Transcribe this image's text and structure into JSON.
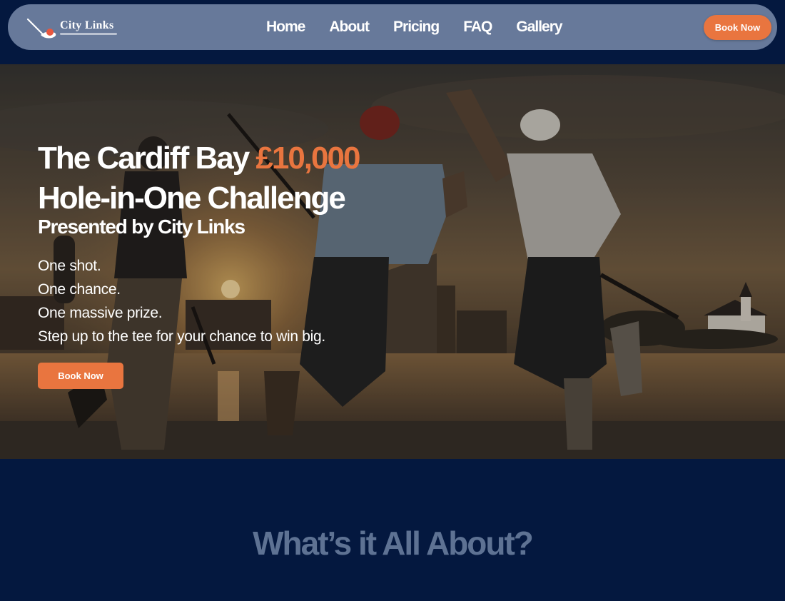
{
  "nav": {
    "logo_text": "City Links",
    "links": [
      "Home",
      "About",
      "Pricing",
      "FAQ",
      "Gallery"
    ],
    "cta_label": "Book Now"
  },
  "hero": {
    "title_part1": "The Cardiff Bay ",
    "title_accent": "£10,000",
    "title_line2": "Hole-in-One Challenge",
    "subtitle": "Presented by City Links",
    "lines": [
      "One shot.",
      "One chance.",
      "One massive prize.",
      "Step up to the tee for your chance to win big."
    ],
    "cta_label": "Book Now"
  },
  "about": {
    "title": "What’s it All About?"
  },
  "colors": {
    "accent": "#e9753f",
    "nav_bg": "#67799a",
    "page_bg": "#04183f",
    "section_title": "#5e7293"
  }
}
